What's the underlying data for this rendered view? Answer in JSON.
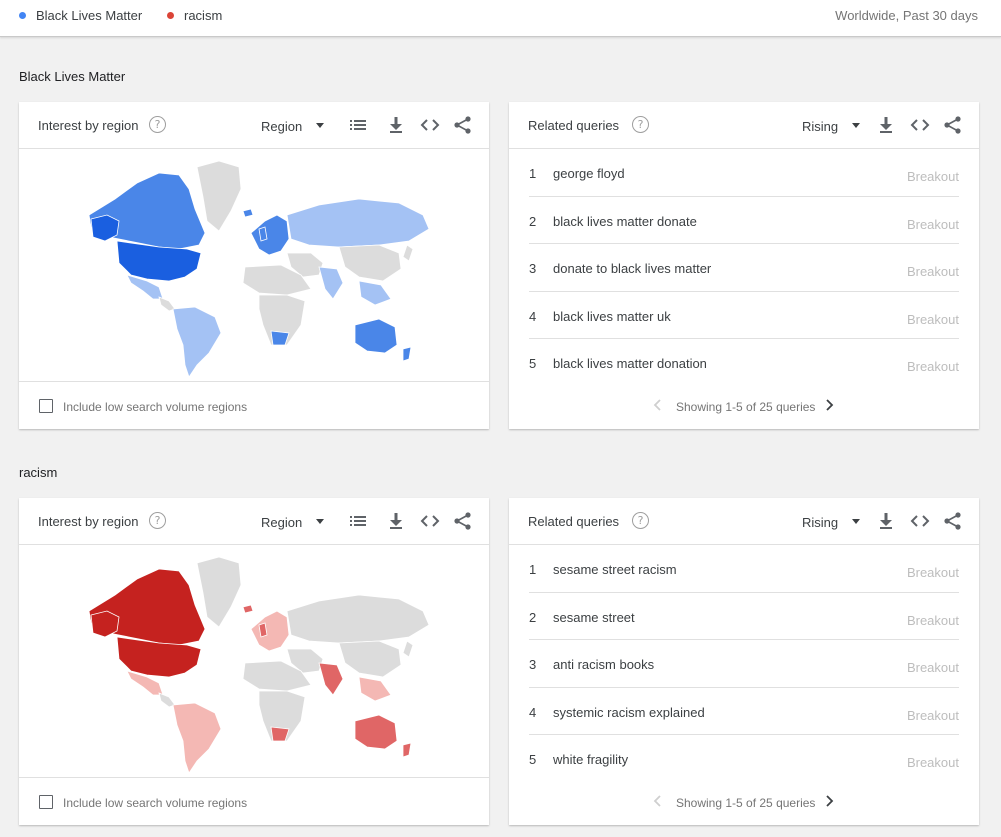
{
  "header": {
    "legend": [
      {
        "label": "Black Lives Matter",
        "color": "#4285f4"
      },
      {
        "label": "racism",
        "color": "#db4437"
      }
    ],
    "scope": "Worldwide, Past 30 days"
  },
  "sections": [
    {
      "title": "Black Lives Matter",
      "region_card": {
        "title": "Interest by region",
        "select": "Region",
        "checkbox_label": "Include low search volume regions",
        "map_palette": {
          "strong": "#1a5fe0",
          "medium": "#4a86e8",
          "light": "#a4c2f4",
          "none": "#dcdcdc"
        }
      },
      "queries_card": {
        "title": "Related queries",
        "select": "Rising",
        "rows": [
          {
            "rank": "1",
            "query": "george floyd",
            "value": "Breakout"
          },
          {
            "rank": "2",
            "query": "black lives matter donate",
            "value": "Breakout"
          },
          {
            "rank": "3",
            "query": "donate to black lives matter",
            "value": "Breakout"
          },
          {
            "rank": "4",
            "query": "black lives matter uk",
            "value": "Breakout"
          },
          {
            "rank": "5",
            "query": "black lives matter donation",
            "value": "Breakout"
          }
        ],
        "pager": "Showing 1-5 of 25 queries"
      }
    },
    {
      "title": "racism",
      "region_card": {
        "title": "Interest by region",
        "select": "Region",
        "checkbox_label": "Include low search volume regions",
        "map_palette": {
          "strong": "#c5221f",
          "medium": "#e06666",
          "light": "#f4b8b4",
          "none": "#dcdcdc"
        }
      },
      "queries_card": {
        "title": "Related queries",
        "select": "Rising",
        "rows": [
          {
            "rank": "1",
            "query": "sesame street racism",
            "value": "Breakout"
          },
          {
            "rank": "2",
            "query": "sesame street",
            "value": "Breakout"
          },
          {
            "rank": "3",
            "query": "anti racism books",
            "value": "Breakout"
          },
          {
            "rank": "4",
            "query": "systemic racism explained",
            "value": "Breakout"
          },
          {
            "rank": "5",
            "query": "white fragility",
            "value": "Breakout"
          }
        ],
        "pager": "Showing 1-5 of 25 queries"
      }
    }
  ],
  "icons": {
    "help": "help-circle-icon",
    "list": "list-view-icon",
    "download": "download-icon",
    "embed": "embed-code-icon",
    "share": "share-icon",
    "prev": "chevron-left-icon",
    "next": "chevron-right-icon",
    "caret": "dropdown-caret-icon"
  }
}
